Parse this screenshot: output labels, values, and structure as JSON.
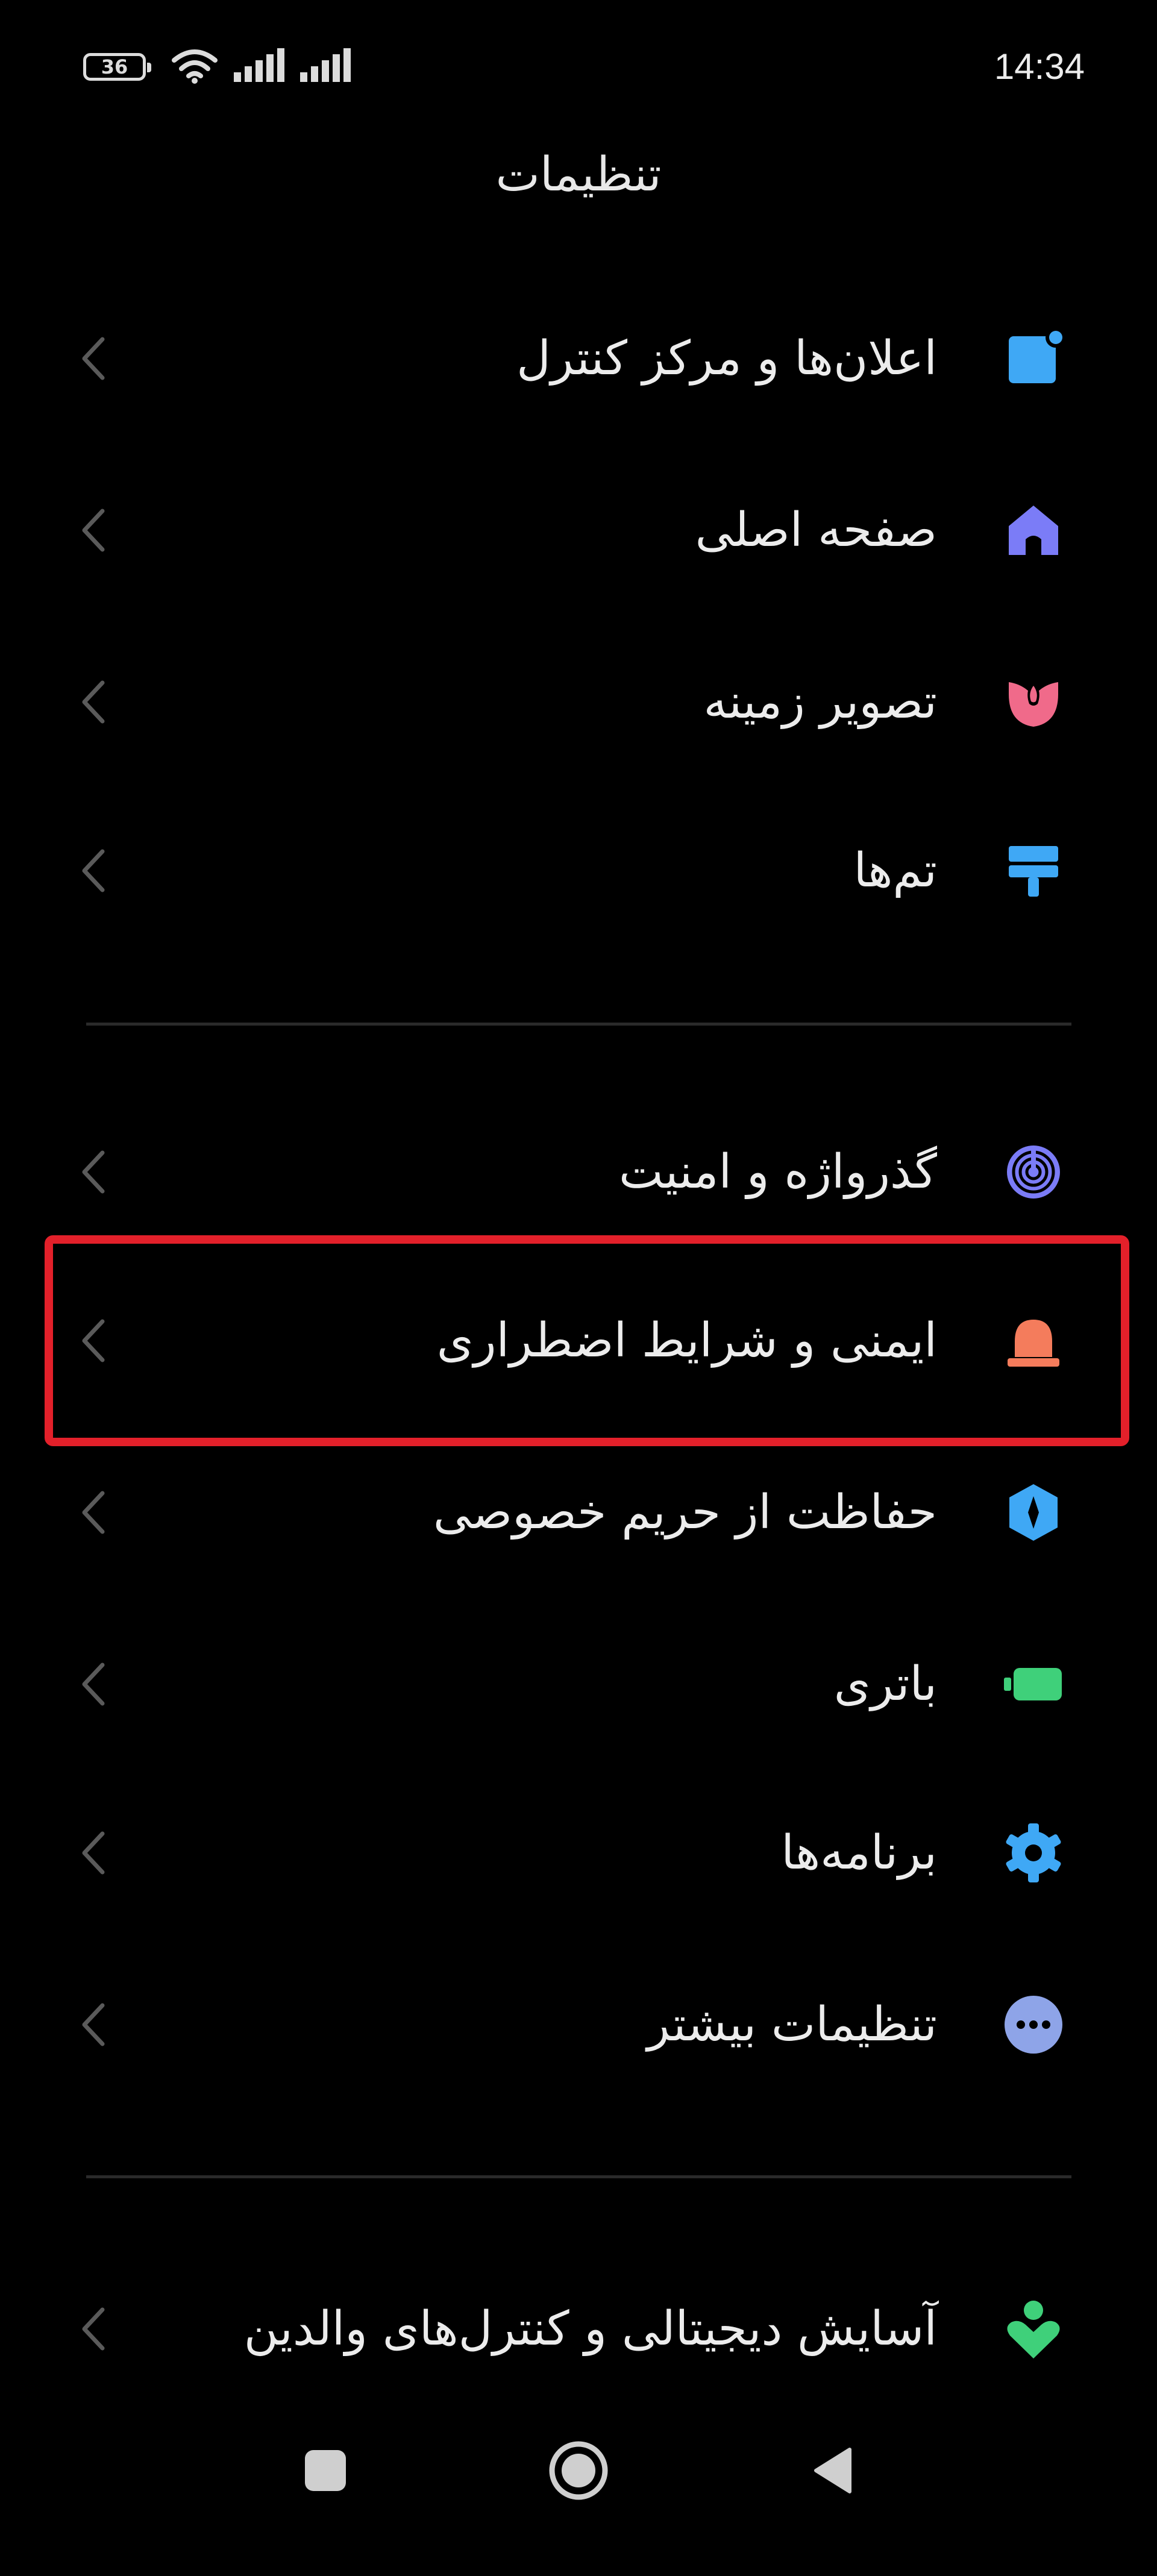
{
  "status_bar": {
    "battery_level": "36",
    "time": "14:34"
  },
  "header": {
    "title": "تنظیمات"
  },
  "group1": [
    {
      "label": "اعلان‌ها و مرکز کنترل",
      "icon": "notification-icon",
      "color": "#3fa8f5"
    },
    {
      "label": "صفحه اصلی",
      "icon": "home-icon",
      "color": "#7b7cf7"
    },
    {
      "label": "تصویر زمینه",
      "icon": "flower-icon",
      "color": "#f06a8a"
    },
    {
      "label": "تم‌ها",
      "icon": "paint-brush-icon",
      "color": "#3fa8f5"
    }
  ],
  "group2": [
    {
      "label": "گذرواژه و امنیت",
      "icon": "fingerprint-icon",
      "color": "#7b7cf7"
    },
    {
      "label": "ایمنی و شرایط اضطراری",
      "icon": "emergency-light-icon",
      "color": "#f47c5c"
    },
    {
      "label": "حفاظت از حریم خصوصی",
      "icon": "privacy-shield-icon",
      "color": "#3fa8f5"
    },
    {
      "label": "باتری",
      "icon": "battery-icon",
      "color": "#3fd07a"
    },
    {
      "label": "برنامه‌ها",
      "icon": "gear-icon",
      "color": "#3fa8f5"
    },
    {
      "label": "تنظیمات بیشتر",
      "icon": "more-dots-icon",
      "color": "#8ea4e8"
    }
  ],
  "group3": [
    {
      "label": "آسایش دیجیتالی و کنترل‌های والدین",
      "icon": "digital-wellbeing-icon",
      "color": "#3fd07a"
    }
  ],
  "colors": {
    "background": "#000000",
    "highlight": "#e3202a",
    "divider": "#2a2a2a"
  }
}
